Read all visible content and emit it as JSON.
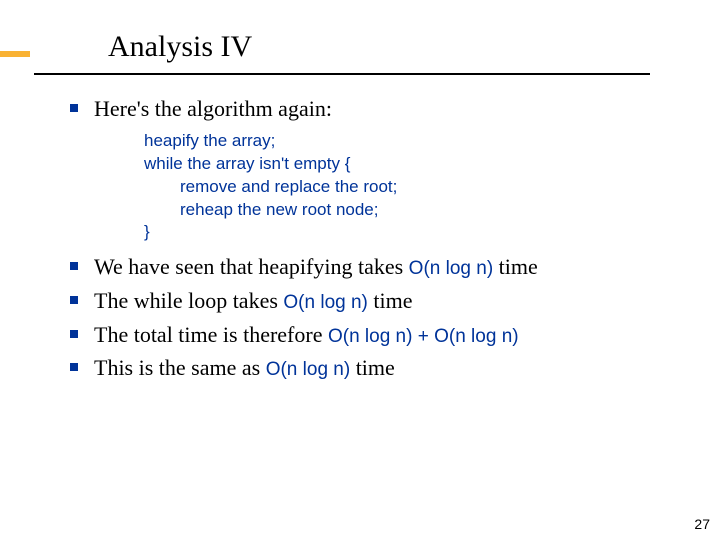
{
  "title": "Analysis IV",
  "bullets": {
    "b0": "Here's the algorithm again:",
    "b1_pre": "We have seen that heapifying takes ",
    "b1_code": "O(n log n)",
    "b1_post": " time",
    "b2_pre": "The while loop takes ",
    "b2_code": "O(n log n)",
    "b2_post": " time",
    "b3_pre": "The total time is therefore ",
    "b3_code1": "O(n log n)",
    "b3_mid": " + ",
    "b3_code2": "O(n log n)",
    "b4_pre": "This is the same as ",
    "b4_code": "O(n log n)",
    "b4_post": " time"
  },
  "code": {
    "l1": "heapify the array;",
    "l2": "while the array isn't empty {",
    "l3": "remove and replace the root;",
    "l4": "reheap the new root node;",
    "l5": "}"
  },
  "page": "27"
}
